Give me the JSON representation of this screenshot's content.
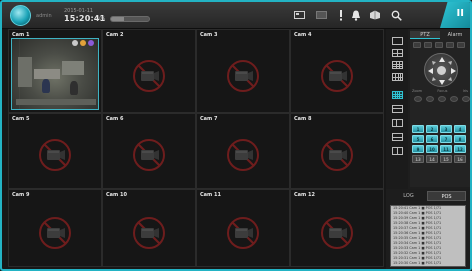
{
  "app": {
    "logo_label": "admin",
    "date": "2015-01-11",
    "clock": "15:20:41",
    "hdd_label": "0%",
    "hdd_fill": 0.35
  },
  "toolbar": {
    "icons": [
      "layout-icon",
      "record-icon",
      "alert-icon",
      "notification-icon",
      "export-icon",
      "search-icon"
    ],
    "badge": "II"
  },
  "cameras": [
    {
      "label": "Cam 1",
      "live": true
    },
    {
      "label": "Cam 2",
      "live": false
    },
    {
      "label": "Cam 3",
      "live": false
    },
    {
      "label": "Cam 4",
      "live": false
    },
    {
      "label": "Cam 5",
      "live": false
    },
    {
      "label": "Cam 6",
      "live": false
    },
    {
      "label": "Cam 7",
      "live": false
    },
    {
      "label": "Cam 8",
      "live": false
    },
    {
      "label": "Cam 9",
      "live": false
    },
    {
      "label": "Cam 10",
      "live": false
    },
    {
      "label": "Cam 11",
      "live": false
    },
    {
      "label": "Cam 12",
      "live": false
    }
  ],
  "panel": {
    "ptz_tabs": [
      "PTZ",
      "Alarm"
    ],
    "ptz_labels": [
      "Zoom",
      "Focus",
      "Iris"
    ],
    "presets": [
      "1",
      "2",
      "3",
      "4",
      "5",
      "6",
      "7",
      "8",
      "9",
      "10",
      "11",
      "12",
      "13",
      "14",
      "15",
      "16"
    ],
    "log_tabs": [
      "LOG",
      "POS"
    ],
    "log_rows": [
      "15:20:41  Cam 1 ■ POS 1/71",
      "15:20:40  Cam 1 ■ POS 1/71",
      "15:20:39  Cam 1 ■ POS 1/71",
      "15:20:38  Cam 1 ■ POS 1/71",
      "15:20:37  Cam 1 ■ POS 1/71",
      "15:20:36  Cam 1 ■ POS 1/71",
      "15:20:35  Cam 1 ■ POS 1/71",
      "15:20:34  Cam 1 ■ POS 1/71",
      "15:20:33  Cam 1 ■ POS 1/71",
      "15:20:32  Cam 1 ■ POS 1/71",
      "15:20:31  Cam 1 ■ POS 1/71",
      "15:20:30  Cam 1 ■ POS 1/71"
    ]
  },
  "colors": {
    "accent": "#23b3c4",
    "nocam_ring": "#7a1f1f"
  }
}
